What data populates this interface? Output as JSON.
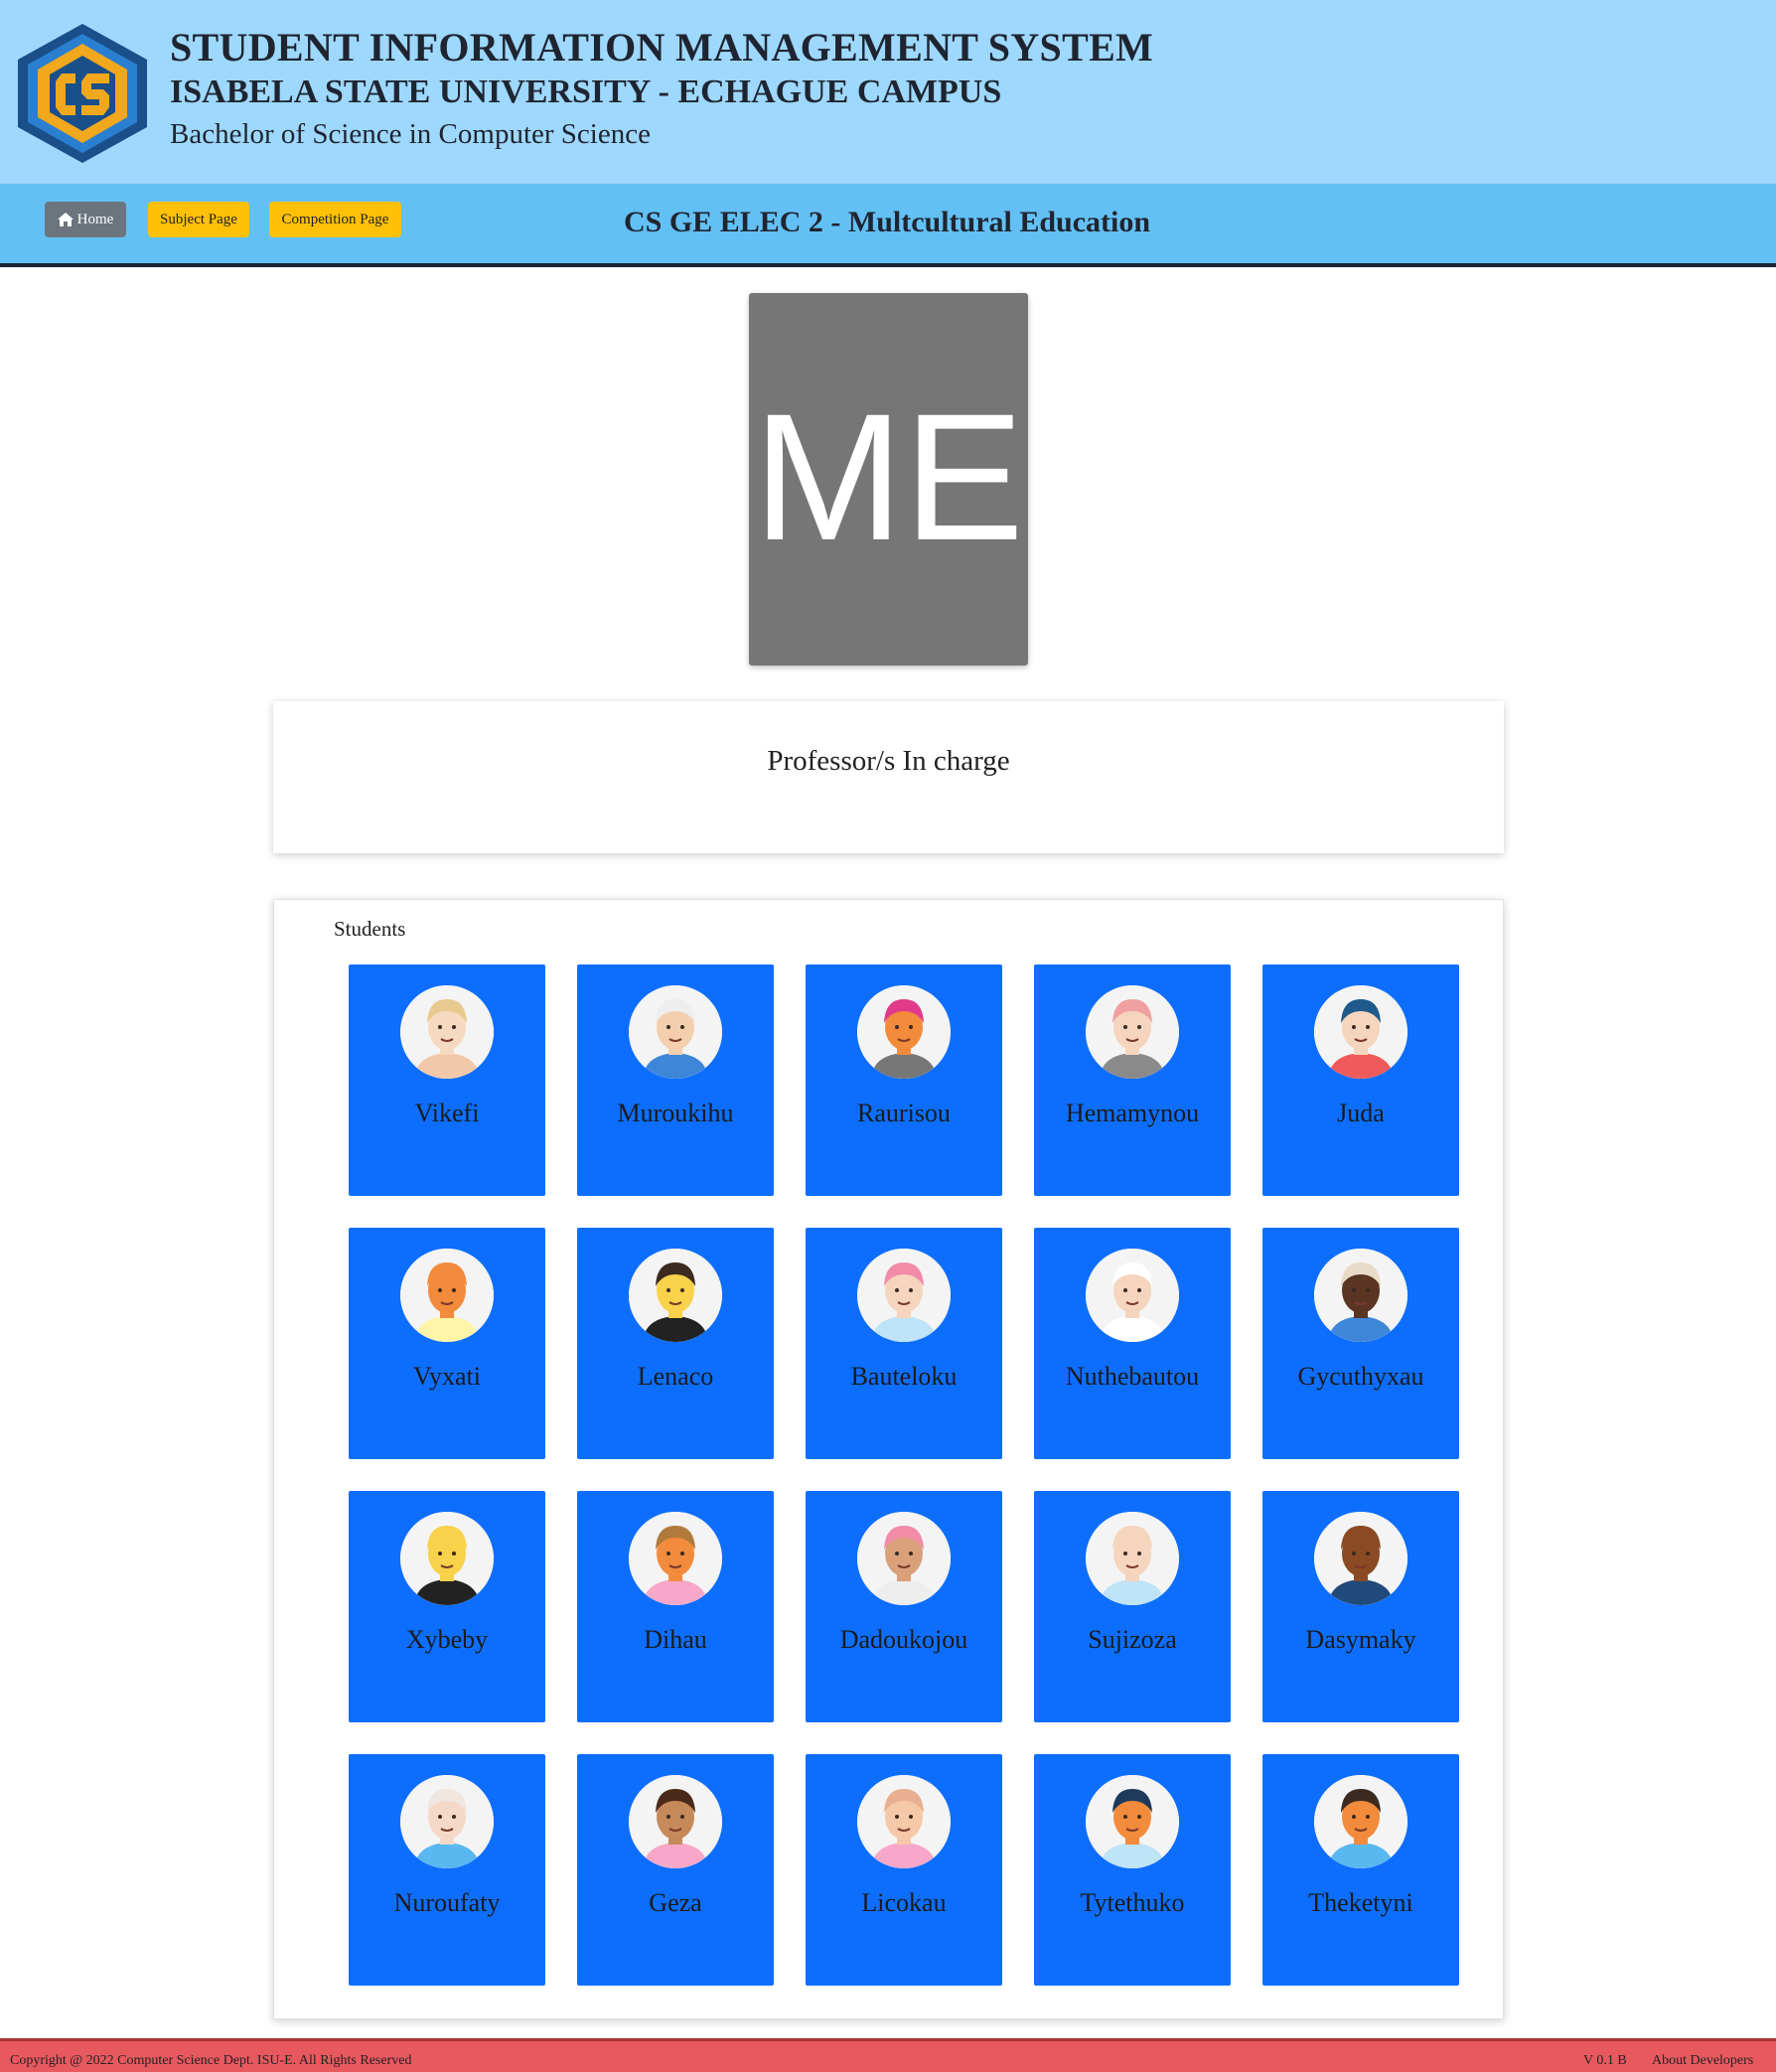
{
  "header": {
    "title": "STUDENT INFORMATION MANAGEMENT SYSTEM",
    "university": "ISABELA STATE UNIVERSITY - ECHAGUE CAMPUS",
    "program": "Bachelor of Science in Computer Science"
  },
  "nav": {
    "home_label": "Home",
    "subject_label": "Subject Page",
    "competition_label": "Competition Page",
    "subject_title": "CS GE ELEC 2 - Multcultural Education"
  },
  "subject_image": {
    "initials": "ME"
  },
  "professor": {
    "heading": "Professor/s In charge"
  },
  "students": {
    "label": "Students",
    "list": [
      {
        "name": "Vikefi",
        "skin": "#f5d9c0",
        "hair": "#e8c98f",
        "shirt": "#f2c9a8"
      },
      {
        "name": "Muroukihu",
        "skin": "#f3cfae",
        "hair": "#eeeeee",
        "shirt": "#3d86d8"
      },
      {
        "name": "Raurisou",
        "skin": "#f28b3c",
        "hair": "#e23a8b",
        "shirt": "#777777"
      },
      {
        "name": "Hemamynou",
        "skin": "#f5d5bd",
        "hair": "#f0a0a0",
        "shirt": "#8a8a8a"
      },
      {
        "name": "Juda",
        "skin": "#f5d5bd",
        "hair": "#1f5a8a",
        "shirt": "#f05a5a"
      },
      {
        "name": "Vyxati",
        "skin": "#f28b3c",
        "hair": "#f28b3c",
        "shirt": "#fff4a8"
      },
      {
        "name": "Lenaco",
        "skin": "#f7d24a",
        "hair": "#3a2a20",
        "shirt": "#222222"
      },
      {
        "name": "Bauteloku",
        "skin": "#f5d5bd",
        "hair": "#f28ba8",
        "shirt": "#bfe3f7"
      },
      {
        "name": "Nuthebautou",
        "skin": "#f5d5bd",
        "hair": "#ffffff",
        "shirt": "#ffffff"
      },
      {
        "name": "Gycuthyxau",
        "skin": "#5a3524",
        "hair": "#e8dcc8",
        "shirt": "#3d86d8"
      },
      {
        "name": "Xybeby",
        "skin": "#f7d24a",
        "hair": "#f7d24a",
        "shirt": "#222222"
      },
      {
        "name": "Dihau",
        "skin": "#f28b3c",
        "hair": "#b07a3c",
        "shirt": "#f7a8c8"
      },
      {
        "name": "Dadoukojou",
        "skin": "#d9a07a",
        "hair": "#f28ba8",
        "shirt": "#eeeeee"
      },
      {
        "name": "Sujizoza",
        "skin": "#f5d5bd",
        "hair": "#f5d5bd",
        "shirt": "#bfe3f7"
      },
      {
        "name": "Dasymaky",
        "skin": "#8a4a24",
        "hair": "#8a4a24",
        "shirt": "#1f4a7a"
      },
      {
        "name": "Nuroufaty",
        "skin": "#f5d9c8",
        "hair": "#f0e6e0",
        "shirt": "#5ab8f0"
      },
      {
        "name": "Geza",
        "skin": "#c68a5a",
        "hair": "#4a2a1a",
        "shirt": "#f7a8c8"
      },
      {
        "name": "Licokau",
        "skin": "#f5c8a8",
        "hair": "#e8b090",
        "shirt": "#f7a8c8"
      },
      {
        "name": "Tytethuko",
        "skin": "#f28b3c",
        "hair": "#1f3a5a",
        "shirt": "#bfe3f7"
      },
      {
        "name": "Theketyni",
        "skin": "#f28b3c",
        "hair": "#3a2a20",
        "shirt": "#5ab8f0"
      }
    ]
  },
  "footer": {
    "copyright": "Copyright @ 2022 Computer Science Dept. ISU-E. All Rights Reserved",
    "version": "V 0.1 B",
    "about": "About Developers"
  }
}
